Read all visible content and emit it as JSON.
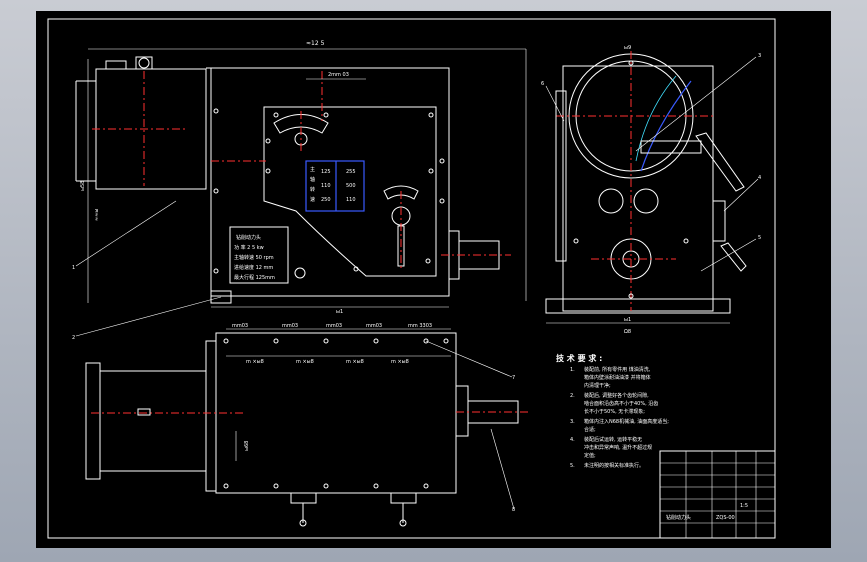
{
  "drawing": {
    "overall_width_dim": "≈12 5",
    "top_dim": "2mm 03",
    "height_dim_1": "ы58",
    "height_dim_2": "≈≈ы",
    "left_bottom_dim": "ы1",
    "right_width_dim": "ы1",
    "right_base_dim": "Ω8",
    "right_top_dim": "ы9",
    "lower_dims": [
      "mm03",
      "mm03",
      "mm03",
      "mm03",
      "mm 3303"
    ],
    "lower_sub_dims": [
      "m ×ы8",
      "m ×ы8",
      "m ×ы8",
      "m ×ы8"
    ],
    "lower_vertical_dim": "ы68",
    "callouts": [
      "1",
      "2",
      "3",
      "4",
      "5",
      "6",
      "7",
      "8"
    ],
    "speed_table": {
      "rows": [
        [
          "125",
          "255"
        ],
        [
          "110",
          "500"
        ],
        [
          "250",
          "110"
        ]
      ],
      "side_labels": [
        "主",
        "轴",
        "转",
        "速"
      ]
    },
    "nameplate": {
      "lines": [
        "钻削动力头",
        "功 率 2 5 kw",
        "主轴转速 50 rpm",
        "进给速度 12 mm",
        "最大行程 125mm"
      ]
    }
  },
  "technical_requirements": {
    "title": "技 术 要 求 :",
    "items": [
      {
        "num": "1.",
        "text": "装配前, 所有零件用  煤油清洗,"
      },
      {
        "num": "",
        "text": "箱体内壁涂耐油油漆  并将箱体"
      },
      {
        "num": "",
        "text": "内清理干净;"
      },
      {
        "num": "2.",
        "text": "装配后, 调整好各个齿轮间隙,"
      },
      {
        "num": "",
        "text": "啮合面积沿齿高不小于40%, 沿齿"
      },
      {
        "num": "",
        "text": "长不小于50%, 无卡滞现象;"
      },
      {
        "num": "3.",
        "text": "箱体内注入N68机械油, 油面高度适当;"
      },
      {
        "num": "",
        "text": "合适;"
      },
      {
        "num": "4.",
        "text": "装配后试运转, 运转平稳无"
      },
      {
        "num": "",
        "text": "冲击和异常声响, 温升不超过规"
      },
      {
        "num": "",
        "text": "定值;"
      },
      {
        "num": "5.",
        "text": "未注明的按相关标准执行。"
      }
    ]
  },
  "title_block": {
    "title": "钻削动力头",
    "drawing_no": "ZQS-00",
    "scale": "1:5"
  },
  "colors": {
    "background": "#000000",
    "outline": "#ffffff",
    "centerline": "#ff3030",
    "blue": "#3a5bff",
    "cyan": "#40e0ff",
    "frame_bg": "#bfc4cc"
  }
}
